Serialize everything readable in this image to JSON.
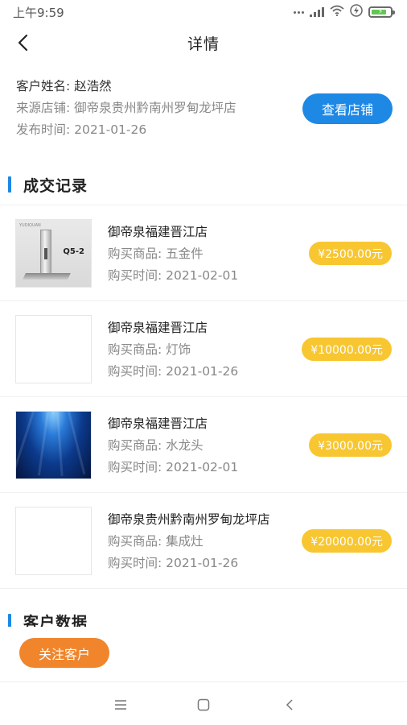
{
  "status_bar": {
    "time": "上午9:59",
    "battery_color": "#64c556"
  },
  "header": {
    "title": "详情",
    "back_icon": "chevron-left-icon"
  },
  "customer": {
    "name_line": "客户姓名: 赵浩然",
    "store_line": "来源店铺: 御帝泉贵州黔南州罗甸龙坪店",
    "date_line": "发布时间: 2021-01-26",
    "view_store_label": "查看店铺"
  },
  "records_section": {
    "title": "成交记录"
  },
  "records": [
    {
      "store": "御帝泉福建晋江店",
      "product": "购买商品: 五金件",
      "date": "购买时间: 2021-02-01",
      "price": "¥2500.00元",
      "thumb": "product-photo",
      "thumb_model": "Q5-2",
      "thumb_brand": "YUDIQUAN"
    },
    {
      "store": "御帝泉福建晋江店",
      "product": "购买商品: 灯饰",
      "date": "购买时间: 2021-01-26",
      "price": "¥10000.00元",
      "thumb": "blank"
    },
    {
      "store": "御帝泉福建晋江店",
      "product": "购买商品: 水龙头",
      "date": "购买时间: 2021-02-01",
      "price": "¥3000.00元",
      "thumb": "blue-water"
    },
    {
      "store": "御帝泉贵州黔南州罗甸龙坪店",
      "product": "购买商品: 集成灶",
      "date": "购买时间: 2021-01-26",
      "price": "¥20000.00元",
      "thumb": "blank"
    }
  ],
  "data_section": {
    "title": "客户数据"
  },
  "follow_button": {
    "label": "关注客户"
  },
  "colors": {
    "primary": "#1e88e5",
    "price_badge": "#f8c630",
    "follow": "#f0852b"
  },
  "nav_bar": {
    "icons": [
      "menu-icon",
      "home-square-icon",
      "back-triangle-icon"
    ]
  }
}
